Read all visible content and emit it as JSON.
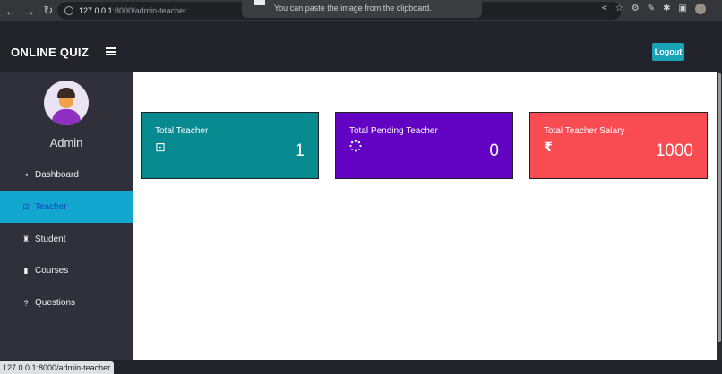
{
  "browser": {
    "url_host": "127.0.0.1",
    "url_path": ":8000/admin-teacher",
    "toast": "You can paste the image from the clipboard.",
    "status_url": "127.0.0.1:8000/admin-teacher"
  },
  "header": {
    "brand": "ONLINE QUIZ",
    "logout_label": "Logout"
  },
  "sidebar": {
    "admin_name": "Admin",
    "items": [
      {
        "label": "Dashboard",
        "icon": "dashboard-icon"
      },
      {
        "label": "Teacher",
        "icon": "teacher-icon",
        "active": true
      },
      {
        "label": "Student",
        "icon": "student-icon"
      },
      {
        "label": "Courses",
        "icon": "book-icon"
      },
      {
        "label": "Questions",
        "icon": "question-icon"
      }
    ]
  },
  "cards": [
    {
      "title": "Total Teacher",
      "value": "1",
      "icon": "chalkboard-teacher-icon",
      "color": "#078990"
    },
    {
      "title": "Total Pending Teacher",
      "value": "0",
      "icon": "spinner-icon",
      "color": "#6203c3"
    },
    {
      "title": "Total Teacher Salary",
      "value": "1000",
      "icon": "rupee-icon",
      "color": "#f94b52"
    }
  ],
  "colors": {
    "active_menu": "#11a7cf",
    "logout": "#17a2b8",
    "topbar": "#23242b",
    "sidebar": "#2f3039"
  }
}
